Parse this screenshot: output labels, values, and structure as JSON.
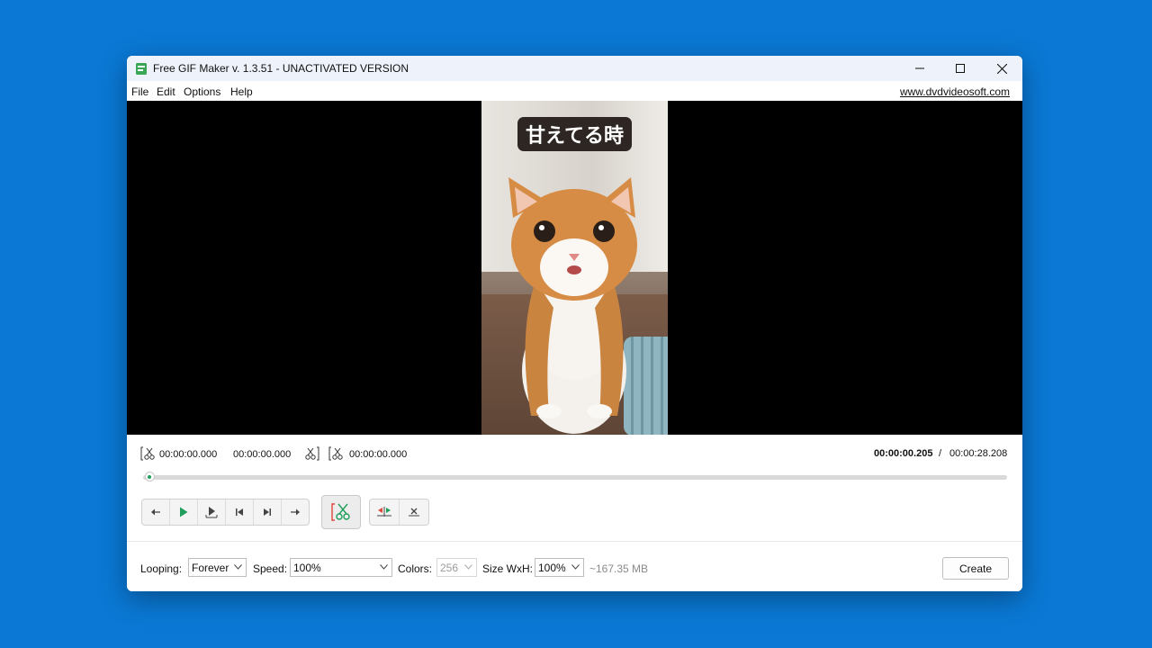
{
  "window": {
    "title": "Free GIF Maker v. 1.3.51 - UNACTIVATED VERSION",
    "icon": "gif-app-icon",
    "controls": [
      "minimize-icon",
      "maximize-icon",
      "close-icon"
    ]
  },
  "menu": {
    "items": [
      "File",
      "Edit",
      "Options",
      "Help"
    ],
    "site_link": "www.dvdvideosoft.com"
  },
  "video": {
    "caption": "甘えてる時"
  },
  "timeline": {
    "start_time": "00:00:00.000",
    "end_time": "00:00:00.000",
    "cut_time": "00:00:00.000",
    "current_time": "00:00:00.205",
    "separator": "/",
    "total_time": "00:00:28.208",
    "position": 0.007
  },
  "controls": {
    "playback": [
      "step-back-icon",
      "play-icon",
      "play-to-end-icon",
      "previous-frame-icon",
      "next-frame-icon",
      "step-forward-icon"
    ],
    "cut": "scissors-icon",
    "edit": [
      "split-marker-icon",
      "remove-marker-icon"
    ]
  },
  "bottom": {
    "looping_label": "Looping:",
    "looping_value": "Forever",
    "speed_label": "Speed:",
    "speed_value": "100%",
    "colors_label": "Colors:",
    "colors_value": "256",
    "size_label": "Size WxH:",
    "size_value": "100%",
    "size_estimate": "~167.35 MB",
    "create_label": "Create"
  },
  "colors": {
    "desktop": "#0a78d4",
    "accent_green": "#1e9e5a"
  }
}
